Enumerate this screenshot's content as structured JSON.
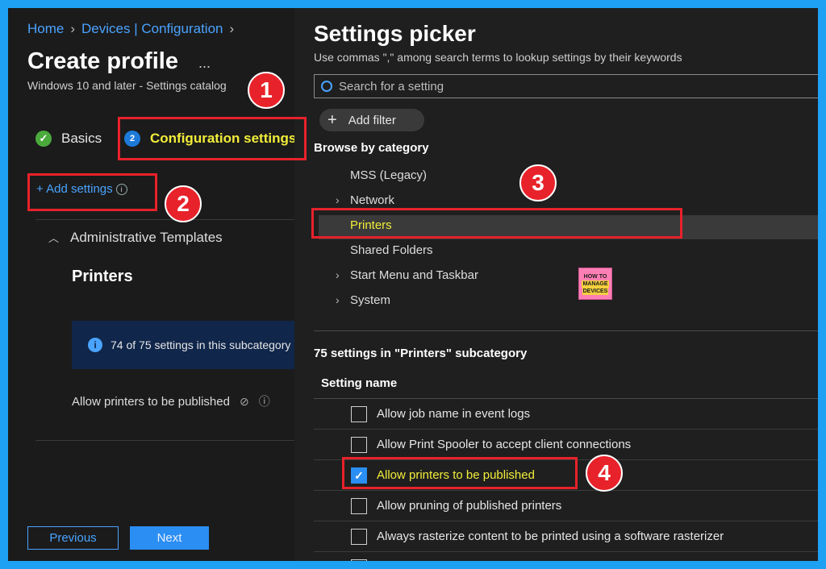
{
  "breadcrumb": {
    "home": "Home",
    "devices": "Devices | Configuration"
  },
  "profile": {
    "title": "Create profile",
    "more": "...",
    "subtitle": "Windows 10 and later - Settings catalog"
  },
  "steps": [
    {
      "label": "Basics",
      "marker": "✓",
      "state": "complete"
    },
    {
      "label": "Configuration settings",
      "marker": "2",
      "state": "current"
    }
  ],
  "left": {
    "add_settings": "+ Add settings",
    "group": "Administrative Templates",
    "subcategory": "Printers",
    "info_text": "74 of 75 settings in this subcategory",
    "setting": "Allow printers to be published",
    "prev_label": "Previous",
    "next_label": "Next"
  },
  "picker": {
    "title": "Settings picker",
    "description": "Use commas \",\" among search terms to lookup settings by their keywords",
    "search_placeholder": "Search for a setting",
    "add_filter": "Add filter",
    "browse_label": "Browse by category",
    "categories": [
      {
        "label": "MSS (Legacy)",
        "expandable": false
      },
      {
        "label": "Network",
        "expandable": true
      },
      {
        "label": "Printers",
        "expandable": false,
        "selected": true
      },
      {
        "label": "Shared Folders",
        "expandable": false
      },
      {
        "label": "Start Menu and Taskbar",
        "expandable": true
      },
      {
        "label": "System",
        "expandable": true
      }
    ],
    "count_label": "75 settings in \"Printers\" subcategory",
    "column_header": "Setting name",
    "settings": [
      {
        "label": "Allow job name in event logs",
        "checked": false
      },
      {
        "label": "Allow Print Spooler to accept client connections",
        "checked": false
      },
      {
        "label": "Allow printers to be published",
        "checked": true
      },
      {
        "label": "Allow pruning of published printers",
        "checked": false
      },
      {
        "label": "Always rasterize content to be printed using a software rasterizer",
        "checked": false
      }
    ]
  },
  "logo": {
    "line1": "HOW TO",
    "line2": "MANAGE",
    "line3": "DEVICES"
  },
  "annotations": [
    "1",
    "2",
    "3",
    "4"
  ],
  "colors": {
    "accent": "#2b8ef3",
    "highlight": "#f2ee3a",
    "annotation": "#e8222a",
    "frame": "#1ea1f2"
  }
}
